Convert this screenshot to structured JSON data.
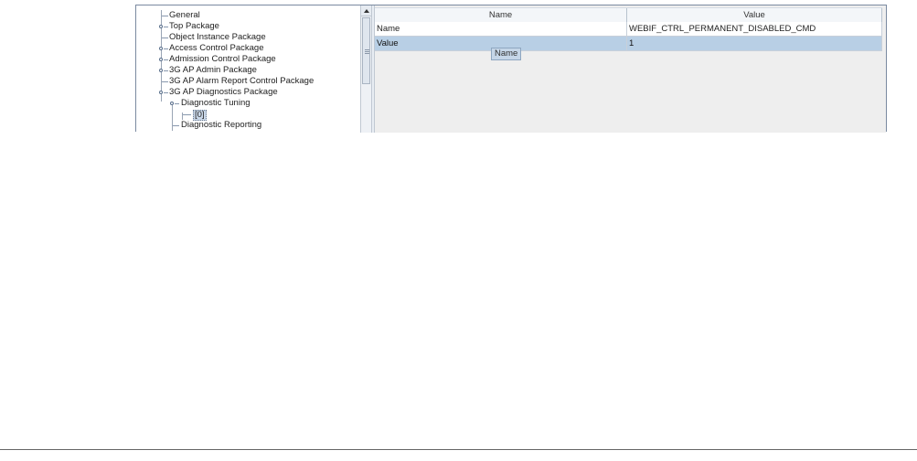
{
  "tree": {
    "items": [
      {
        "label": "General",
        "expandable": false
      },
      {
        "label": "Top Package",
        "expandable": true
      },
      {
        "label": "Object Instance Package",
        "expandable": false
      },
      {
        "label": "Access Control Package",
        "expandable": true
      },
      {
        "label": "Admission Control Package",
        "expandable": true
      },
      {
        "label": "3G AP Admin Package",
        "expandable": true
      },
      {
        "label": "3G AP Alarm Report Control Package",
        "expandable": false
      },
      {
        "label": "3G AP Diagnostics Package",
        "expandable": true,
        "expanded": true
      },
      {
        "label": "Diagnostic Tuning",
        "expandable": true,
        "expanded": true
      },
      {
        "label": "[0]",
        "selected": true
      },
      {
        "label": "Diagnostic Reporting",
        "expandable": false
      }
    ]
  },
  "table": {
    "columns": [
      "Name",
      "Value"
    ],
    "rows": [
      {
        "name": "Name",
        "value": "WEBIF_CTRL_PERMANENT_DISABLED_CMD",
        "selected": false
      },
      {
        "name": "Value",
        "value": "1",
        "selected": true
      }
    ],
    "tooltip": "Name"
  },
  "colors": {
    "selection": "#b8cfe5",
    "header": "#f3f6f9",
    "border": "#7a8aa0"
  }
}
